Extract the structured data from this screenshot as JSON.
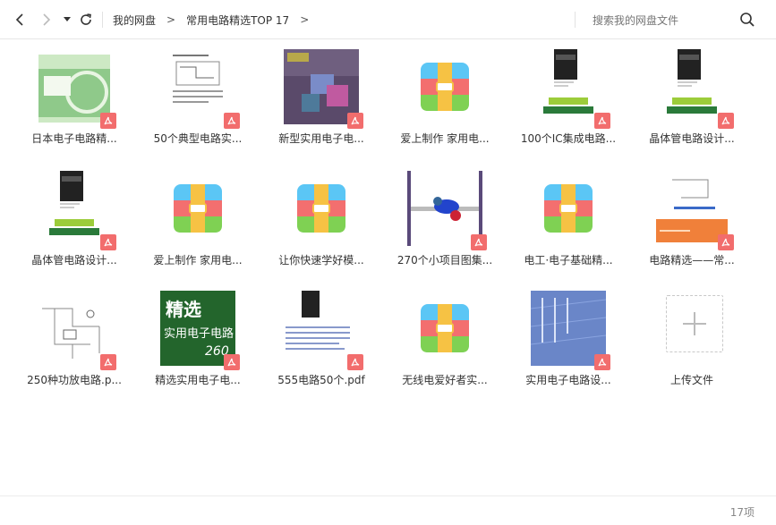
{
  "nav": {
    "back": "back",
    "forward": "forward",
    "history": "history",
    "refresh": "refresh"
  },
  "breadcrumb": {
    "root": "我的网盘",
    "sep1": ">",
    "folder": "常用电路精选TOP 17",
    "sep2": ">"
  },
  "search": {
    "placeholder": "搜索我的网盘文件"
  },
  "files": [
    {
      "name": "日本电子电路精...",
      "kind": "pdf",
      "thumb": "green-book"
    },
    {
      "name": "50个典型电路实...",
      "kind": "pdf",
      "thumb": "doc-page"
    },
    {
      "name": "新型实用电子电...",
      "kind": "pdf",
      "thumb": "purple-cover"
    },
    {
      "name": "爱上制作 家用电...",
      "kind": "archive",
      "thumb": "archive"
    },
    {
      "name": "100个IC集成电路...",
      "kind": "pdf",
      "thumb": "circuits-book"
    },
    {
      "name": "晶体管电路设计...",
      "kind": "pdf",
      "thumb": "circuits-book"
    },
    {
      "name": "晶体管电路设计...",
      "kind": "pdf",
      "thumb": "circuits-book"
    },
    {
      "name": "爱上制作 家用电...",
      "kind": "archive",
      "thumb": "archive"
    },
    {
      "name": "让你快速学好模...",
      "kind": "archive",
      "thumb": "archive"
    },
    {
      "name": "270个小项目图集...",
      "kind": "pdf",
      "thumb": "robot"
    },
    {
      "name": "电工·电子基础精...",
      "kind": "archive",
      "thumb": "archive"
    },
    {
      "name": "电路精选——常...",
      "kind": "pdf",
      "thumb": "orange-doc"
    },
    {
      "name": "250种功放电路.p...",
      "kind": "pdf",
      "thumb": "schematic"
    },
    {
      "name": "精选实用电子电...",
      "kind": "pdf",
      "thumb": "green-260"
    },
    {
      "name": "555电路50个.pdf",
      "kind": "pdf",
      "thumb": "circuits-small"
    },
    {
      "name": "无线电爱好者实...",
      "kind": "archive",
      "thumb": "archive"
    },
    {
      "name": "实用电子电路设...",
      "kind": "pdf",
      "thumb": "blue-cover"
    },
    {
      "name": "上传文件",
      "kind": "upload",
      "thumb": "upload"
    }
  ],
  "footer": {
    "count": "17项"
  },
  "colors": {
    "pdf": "#f26d6d",
    "arch_blue": "#5bc6f5",
    "arch_red": "#f36f6f",
    "arch_green": "#7fd153",
    "arch_yellow": "#f6c244"
  }
}
